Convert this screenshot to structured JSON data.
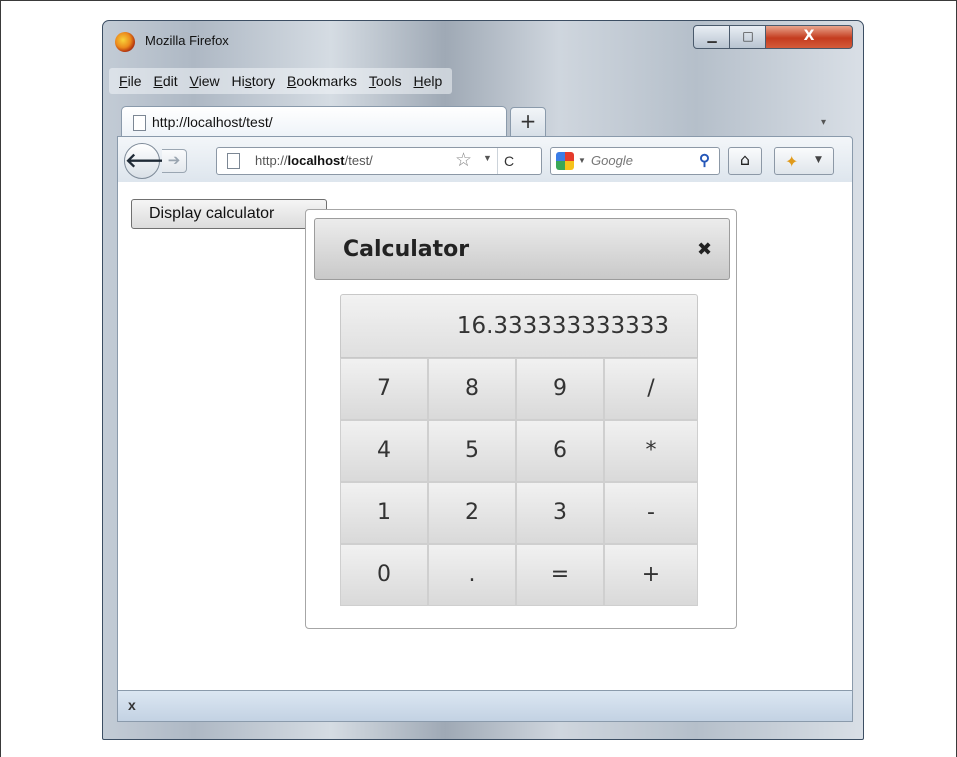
{
  "window": {
    "title": "Mozilla Firefox",
    "min_glyph": "▁",
    "max_glyph": "□",
    "close_glyph": "X"
  },
  "menu": [
    "File",
    "Edit",
    "View",
    "History",
    "Bookmarks",
    "Tools",
    "Help"
  ],
  "tab": {
    "label": "http://localhost/test/",
    "new_tab_glyph": "+"
  },
  "navbar": {
    "back_glyph": "🡐",
    "forward_glyph": "➔",
    "url_prefix": "http://",
    "url_host": "localhost",
    "url_path": "/test/",
    "reload_glyph": "C",
    "search_placeholder": "Google",
    "search_glyph": "⚲",
    "home_glyph": "⌂"
  },
  "page": {
    "display_button_label": "Display calculator"
  },
  "dialog": {
    "title": "Calculator",
    "close_glyph": "✖",
    "display_value": "16.333333333333",
    "keys": [
      "7",
      "8",
      "9",
      "/",
      "4",
      "5",
      "6",
      "*",
      "1",
      "2",
      "3",
      "-",
      "0",
      ".",
      "=",
      "+"
    ]
  },
  "statusbar": {
    "close_glyph": "x"
  },
  "colors": {
    "close_button": "#c43c1f",
    "dialog_header": "#d9d9d9"
  },
  "icons": [
    "firefox-logo-icon",
    "page-icon",
    "star-icon",
    "google-icon",
    "search-icon",
    "home-icon",
    "addon-icon"
  ]
}
